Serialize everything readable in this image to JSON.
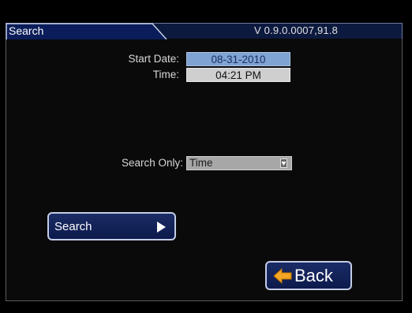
{
  "window": {
    "tab_title": "Search",
    "version": "V 0.9.0.0007,91.8"
  },
  "form": {
    "start_date_label": "Start Date:",
    "start_date_value": "08-31-2010",
    "time_label": "Time:",
    "time_value": "04:21 PM",
    "search_only_label": "Search Only:",
    "search_only_value": "Time"
  },
  "buttons": {
    "search_label": "Search",
    "back_label": "Back"
  },
  "icons": {
    "search_button_icon": "play-arrow-icon",
    "back_button_icon": "back-arrow-icon",
    "select_icon": "dropdown-arrow-icon"
  },
  "colors": {
    "header_bg": "#0d1a3f",
    "date_field_bg": "#7fa3d2",
    "time_field_bg": "#cfcfcf",
    "button_bg": "#1b2c66",
    "back_arrow": "#f5a623"
  }
}
